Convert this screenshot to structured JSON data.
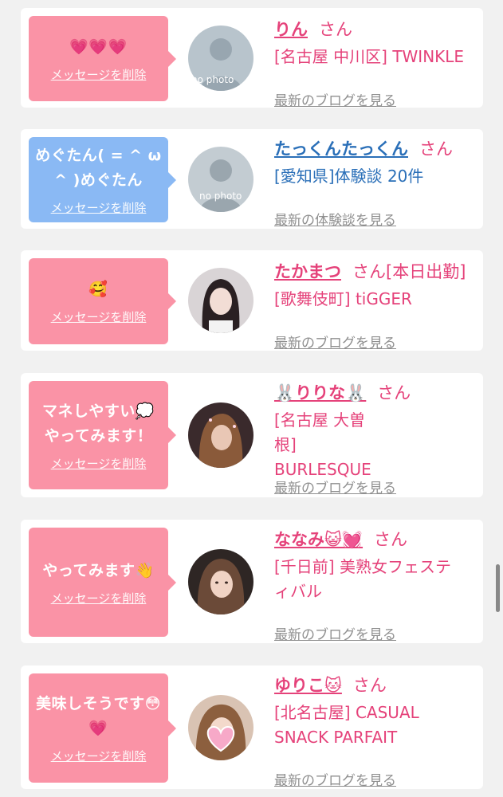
{
  "colors": {
    "bubble_pink": "#fa93a6",
    "bubble_blue": "#8ab9f4",
    "name_pink": "#e5427a",
    "name_blue": "#2a6fb8",
    "link_gray": "#8f8f8f"
  },
  "items": [
    {
      "bubble_text": "💗💗💗",
      "delete_label": "メッセージを削除",
      "name": "りん",
      "suffix": "さん",
      "status": "",
      "shop": "[名古屋 中川区] TWINKLE",
      "link": "最新のブログを見る",
      "avatar": "no photo"
    },
    {
      "bubble_text": "めぐたん( = ^ ω ^ )めぐたん",
      "delete_label": "メッセージを削除",
      "name": "たっくんたっくん",
      "suffix": "さん",
      "status": "",
      "shop": "[愛知県]体験談 20件",
      "link": "最新の体験談を見る",
      "avatar": "no photo"
    },
    {
      "bubble_text": "🥰",
      "delete_label": "メッセージを削除",
      "name": "たかまつ",
      "suffix": "さん",
      "status": "[本日出勤]",
      "shop": "[歌舞伎町] tiGGER",
      "link": "最新のブログを見る",
      "avatar": "photo"
    },
    {
      "bubble_text": "マネしやすい💭やってみます！",
      "delete_label": "メッセージを削除",
      "name": "🐰りりな🐰",
      "suffix": "さん",
      "status": "",
      "shop": "[名古屋 大曽根] BURLESQUE",
      "link": "最新のブログを見る",
      "avatar": "photo"
    },
    {
      "bubble_text": "やってみます👋",
      "delete_label": "メッセージを削除",
      "name": "ななみ😺💓",
      "suffix": "さん",
      "status": "",
      "shop": "[千日前] 美熟女フェスティバル",
      "link": "最新のブログを見る",
      "avatar": "photo"
    },
    {
      "bubble_text": "美味しそうです😳💗",
      "delete_label": "メッセージを削除",
      "name": "ゆりこ🐱",
      "suffix": "さん",
      "status": "",
      "shop": "[北名古屋] CASUAL SNACK PARFAIT",
      "link": "最新のブログを見る",
      "avatar": "photo"
    }
  ]
}
